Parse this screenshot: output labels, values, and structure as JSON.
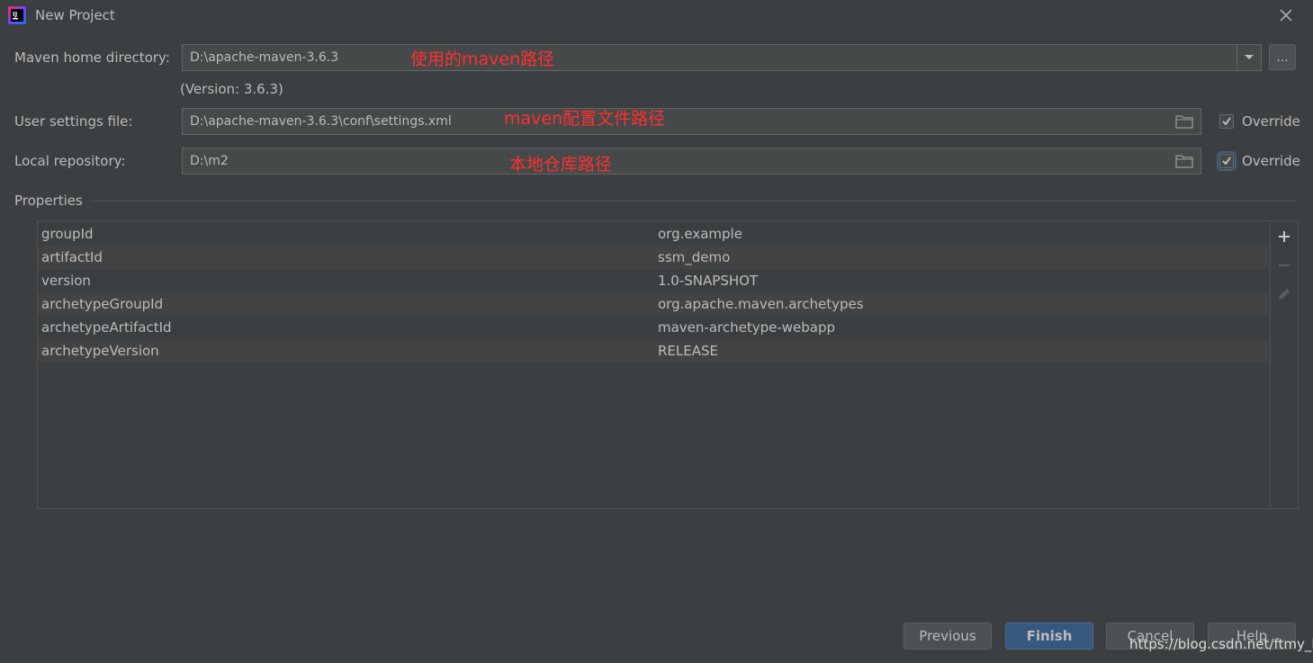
{
  "window": {
    "title": "New Project"
  },
  "maven_home": {
    "label": "Maven home directory:",
    "value": "D:\\apache-maven-3.6.3",
    "version_text": "(Version: 3.6.3)",
    "browse_label": "...",
    "annotation": "使用的maven路径"
  },
  "user_settings": {
    "label": "User settings file:",
    "value": "D:\\apache-maven-3.6.3\\conf\\settings.xml",
    "override_label": "Override",
    "override_checked": true,
    "annotation": "maven配置文件路径"
  },
  "local_repo": {
    "label": "Local repository:",
    "value": "D:\\m2",
    "override_label": "Override",
    "override_checked": true,
    "annotation": "本地仓库路径"
  },
  "properties": {
    "title": "Properties",
    "rows": [
      {
        "key": "groupId",
        "value": "org.example"
      },
      {
        "key": "artifactId",
        "value": "ssm_demo"
      },
      {
        "key": "version",
        "value": "1.0-SNAPSHOT"
      },
      {
        "key": "archetypeGroupId",
        "value": "org.apache.maven.archetypes"
      },
      {
        "key": "archetypeArtifactId",
        "value": "maven-archetype-webapp"
      },
      {
        "key": "archetypeVersion",
        "value": "RELEASE"
      }
    ],
    "toolbar_icons": [
      "add-icon",
      "remove-icon",
      "edit-icon"
    ]
  },
  "buttons": {
    "previous": "Previous",
    "finish": "Finish",
    "cancel": "Cancel",
    "help": "Help"
  },
  "watermark": "https://blog.csdn.net/ftmy_l",
  "colors": {
    "background": "#3c3f41",
    "field_background": "#45494a",
    "annotation": "#ff3030",
    "primary_button": "#365880",
    "text": "#bbbbbb"
  }
}
